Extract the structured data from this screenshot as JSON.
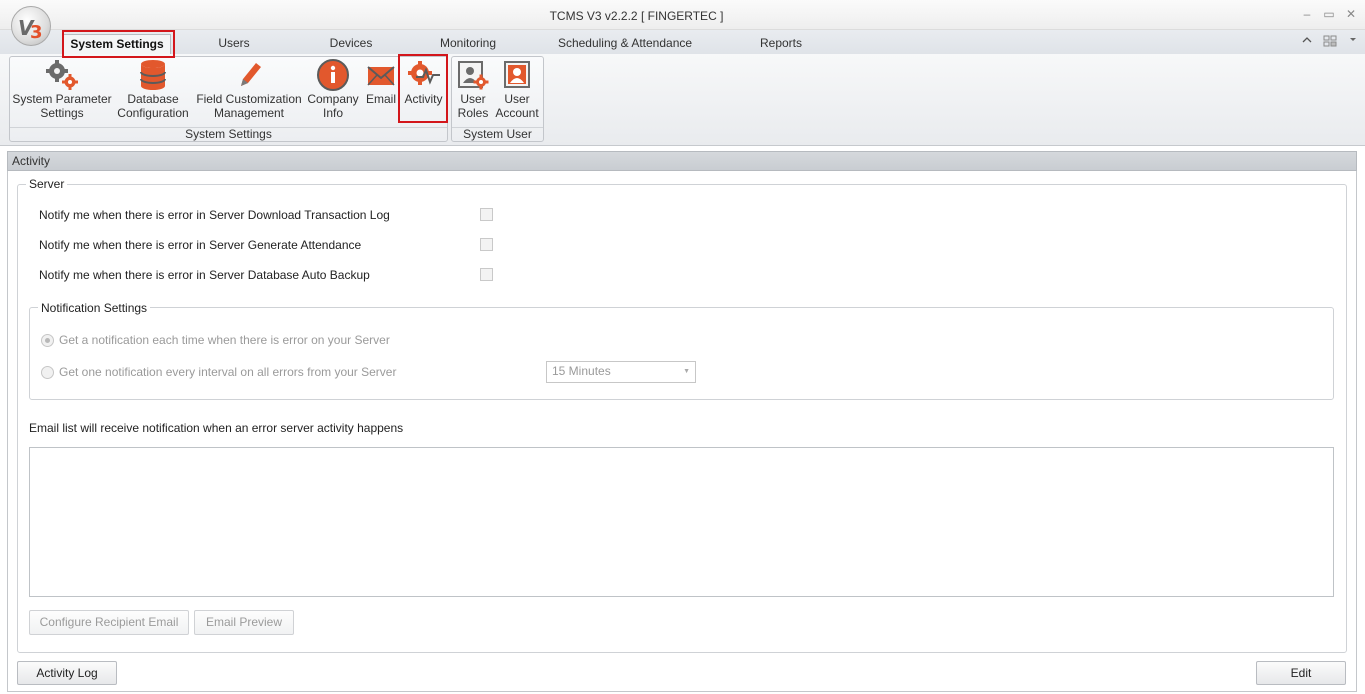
{
  "window": {
    "title": "TCMS V3 v2.2.2 [ FINGERTEC ]",
    "logo_text": "V3",
    "controls": [
      "–",
      "▭",
      "✕"
    ]
  },
  "menu": {
    "tabs": [
      {
        "label": "System Settings"
      },
      {
        "label": "Users"
      },
      {
        "label": "Devices"
      },
      {
        "label": "Monitoring"
      },
      {
        "label": "Scheduling & Attendance"
      },
      {
        "label": "Reports"
      }
    ],
    "right_icons": [
      "collapse-ribbon-icon",
      "layout-icon",
      "dropdown-icon"
    ]
  },
  "ribbon": {
    "system_settings_group": {
      "label": "System Settings",
      "buttons": [
        {
          "line1": "System Parameter",
          "line2": "Settings",
          "icon": "gears-icon"
        },
        {
          "line1": "Database",
          "line2": "Configuration",
          "icon": "database-icon"
        },
        {
          "line1": "Field Customization",
          "line2": "Management",
          "icon": "pencil-icon"
        },
        {
          "line1": "Company",
          "line2": "Info",
          "icon": "info-icon"
        },
        {
          "line1": "Email",
          "line2": "",
          "icon": "envelope-icon"
        },
        {
          "line1": "Activity",
          "line2": "",
          "icon": "activity-gear-icon"
        }
      ]
    },
    "system_user_group": {
      "label": "System User",
      "buttons": [
        {
          "line1": "User",
          "line2": "Roles",
          "icon": "user-roles-icon"
        },
        {
          "line1": "User",
          "line2": "Account",
          "icon": "user-account-icon"
        }
      ]
    }
  },
  "panel": {
    "title": "Activity",
    "server": {
      "legend": "Server",
      "options": [
        {
          "label": "Notify me when there is error in Server Download Transaction Log",
          "checked": false
        },
        {
          "label": "Notify me when there is error in Server Generate Attendance",
          "checked": false
        },
        {
          "label": "Notify me when there is error in Server Database Auto Backup",
          "checked": false
        }
      ]
    },
    "notification": {
      "legend": "Notification Settings",
      "option_each": "Get a notification each time when there is error on your Server",
      "option_interval": "Get one notification every interval on all errors from your Server",
      "interval_value": "15 Minutes"
    },
    "email_list_label": "Email list will receive notification when an error server activity happens",
    "email_list_value": "",
    "configure_button": "Configure Recipient Email",
    "preview_button": "Email Preview"
  },
  "footer": {
    "activity_log_button": "Activity Log",
    "edit_button": "Edit"
  }
}
